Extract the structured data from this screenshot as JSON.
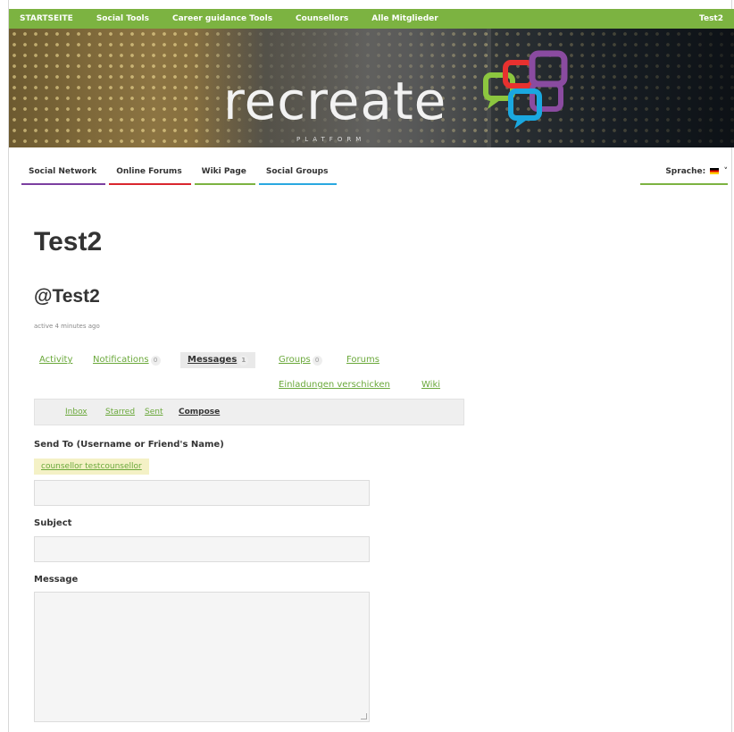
{
  "topbar": {
    "items": [
      "STARTSEITE",
      "Social Tools",
      "Career guidance Tools",
      "Counsellors",
      "Alle Mitglieder"
    ],
    "user": "Test2"
  },
  "banner": {
    "logo_text": "recreate",
    "logo_sub": "PLATFORM"
  },
  "subnav": {
    "tabs": [
      {
        "label": "Social Network",
        "color": "#7b3fa0"
      },
      {
        "label": "Online Forums",
        "color": "#d9262e"
      },
      {
        "label": "Wiki Page",
        "color": "#7cb341"
      },
      {
        "label": "Social Groups",
        "color": "#29a8e0"
      }
    ],
    "language_label": "Sprache:"
  },
  "profile": {
    "title": "Test2",
    "handle": "@Test2",
    "activity": "active 4 minutes ago"
  },
  "profile_tabs": {
    "activity": "Activity",
    "notifications": "Notifications",
    "notifications_count": "0",
    "messages": "Messages",
    "messages_count": "1",
    "groups": "Groups",
    "groups_count": "0",
    "forums": "Forums",
    "invitations": "Einladungen verschicken",
    "wiki": "Wiki"
  },
  "message_tabs": {
    "inbox": "Inbox",
    "starred": "Starred",
    "sent": "Sent",
    "compose": "Compose"
  },
  "compose": {
    "send_to_label": "Send To (Username or Friend's Name)",
    "recipient": "counsellor testcounsellor",
    "subject_label": "Subject",
    "message_label": "Message"
  },
  "colors": {
    "accent": "#7cb341",
    "link": "#6aa83a"
  }
}
